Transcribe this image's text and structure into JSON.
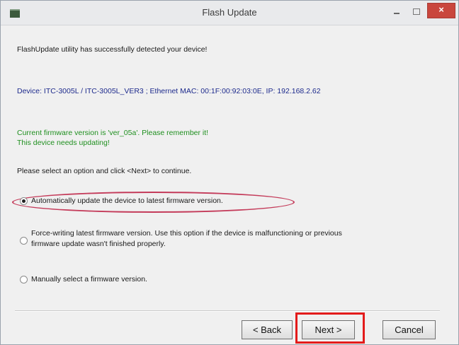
{
  "window": {
    "title": "Flash Update",
    "close_label": "×"
  },
  "content": {
    "detected_message": "FlashUpdate utility has successfully detected your device!",
    "device_info": "Device: ITC-3005L / ITC-3005L_VER3 ; Ethernet MAC: 00:1F:00:92:03:0E, IP: 192.168.2.62",
    "firmware_status_line1": "Current firmware version is 'ver_05a'. Please remember it!",
    "firmware_status_line2": "This device needs updating!",
    "instruction": "Please select an option and click <Next> to continue.",
    "options": [
      {
        "label": "Automatically update the device to latest firmware version.",
        "selected": true
      },
      {
        "label": "Force-writing latest firmware version. Use this option if the device is malfunctioning or previous",
        "label_line2": "firmware update wasn't finished properly.",
        "selected": false
      },
      {
        "label": "Manually select a firmware version.",
        "selected": false
      }
    ]
  },
  "buttons": {
    "back": "< Back",
    "next": "Next >",
    "cancel": "Cancel"
  },
  "colors": {
    "annotation_ellipse": "#c43b5a",
    "annotation_box": "#e31b1b",
    "device_text": "#1d2a8c",
    "status_text": "#1f8f1f"
  }
}
